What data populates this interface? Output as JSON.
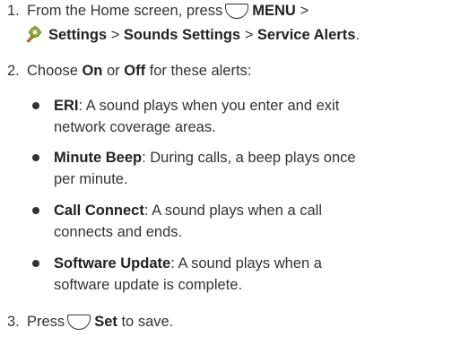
{
  "step1": {
    "num": "1.",
    "pre": "From the Home screen, press",
    "menu": "MENU",
    "sep1": ">",
    "settings": "Settings",
    "sep2": ">",
    "sounds": "Sounds Settings",
    "sep3": ">",
    "alerts": "Service Alerts",
    "end": "."
  },
  "step2": {
    "num": "2.",
    "pre": "Choose",
    "on": "On",
    "or": "or",
    "off": "Off",
    "post": "for these alerts:"
  },
  "alerts": [
    {
      "term": "ERI",
      "line1": ": A sound plays when you enter and exit",
      "line2": "network coverage areas."
    },
    {
      "term": "Minute Beep",
      "line1": ": During calls, a beep plays once",
      "line2": "per minute."
    },
    {
      "term": "Call Connect",
      "line1": ": A sound plays when a call",
      "line2": "connects and ends."
    },
    {
      "term": "Software Update",
      "line1": ": A sound plays when a",
      "line2": "software update is complete."
    }
  ],
  "step3": {
    "num": "3.",
    "pre": "Press",
    "set": "Set",
    "post": "to save."
  }
}
